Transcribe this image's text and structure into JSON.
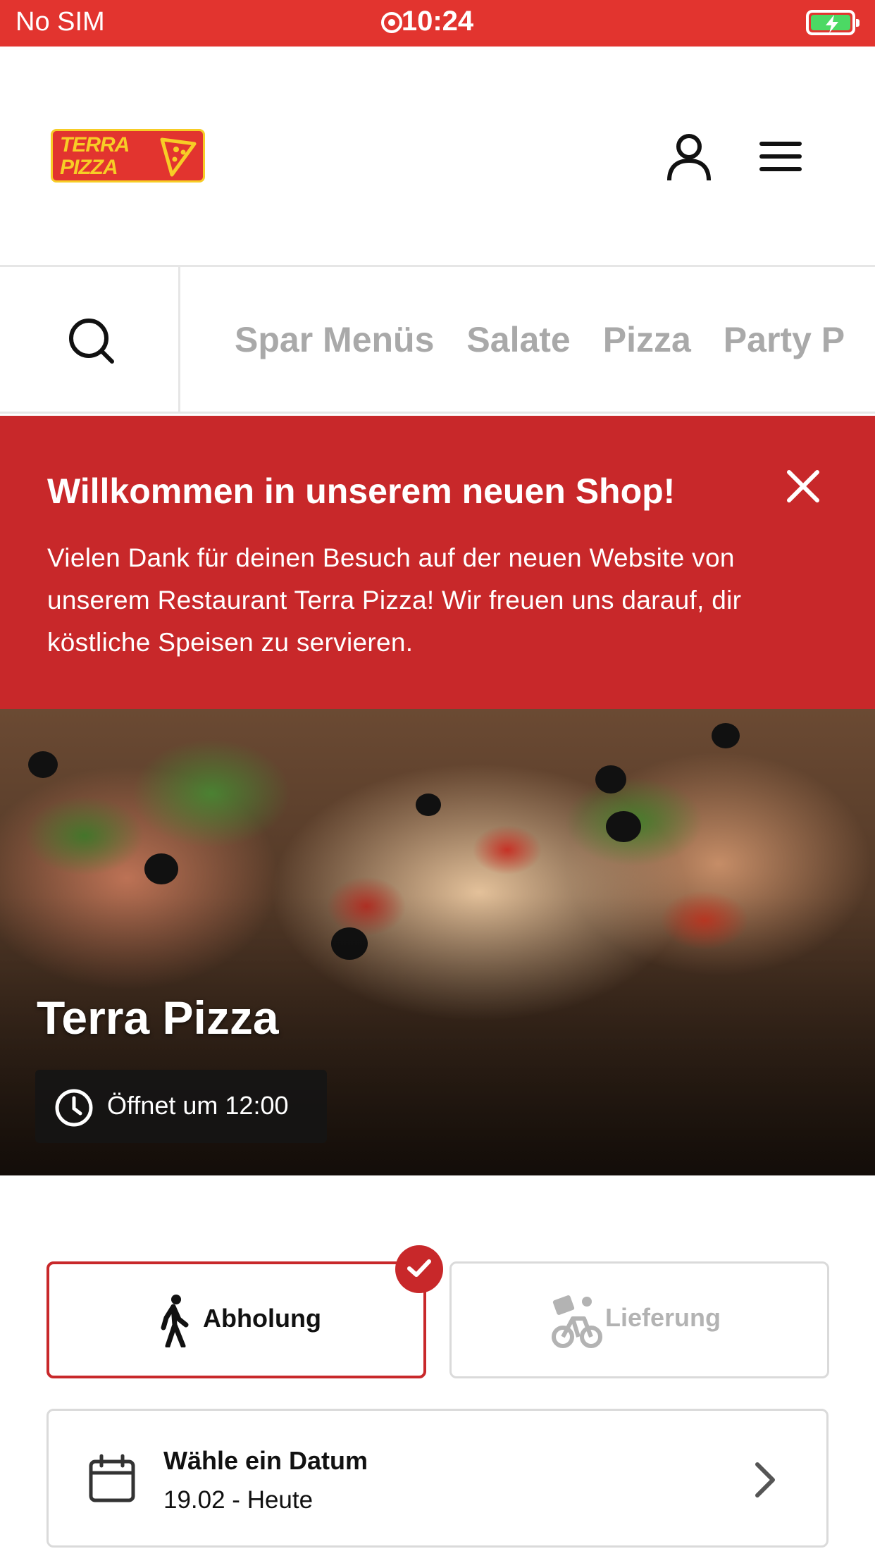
{
  "status_bar": {
    "carrier": "No SIM",
    "time": "10:24",
    "battery_state": "charging",
    "bar_color": "#e2342f"
  },
  "header": {
    "logo_text_line1": "TERRA",
    "logo_text_line2": "PIZZA",
    "user_icon": "user-icon",
    "menu_icon": "hamburger-menu-icon"
  },
  "nav": {
    "search_icon": "search-icon",
    "categories": [
      "Spar Menüs",
      "Salate",
      "Pizza",
      "Party P"
    ]
  },
  "welcome_banner": {
    "title": "Willkommen in unserem neuen Shop!",
    "text": "Vielen Dank für deinen Besuch auf der neuen Website von unserem Restaurant Terra Pizza! Wir freuen uns darauf, dir köstliche Speisen zu servieren.",
    "background": "#c8282a"
  },
  "hero": {
    "restaurant_name": "Terra Pizza",
    "opening_info": "Öffnet um 12:00"
  },
  "order_mode": {
    "pickup_label": "Abholung",
    "delivery_label": "Lieferung",
    "selected": "pickup"
  },
  "date_picker": {
    "title": "Wähle ein Datum",
    "value": "19.02 - Heute"
  }
}
